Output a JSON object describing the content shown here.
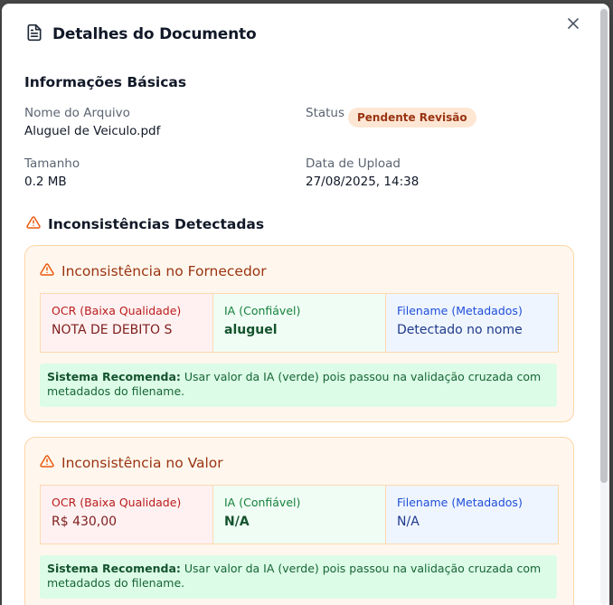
{
  "header": {
    "title": "Detalhes do Documento"
  },
  "basic_info": {
    "section_title": "Informações Básicas",
    "filename_label": "Nome do Arquivo",
    "filename_value": "Aluguel de Veiculo.pdf",
    "status_label": "Status",
    "status_value": "Pendente Revisão",
    "size_label": "Tamanho",
    "size_value": "0.2 MB",
    "upload_label": "Data de Upload",
    "upload_value": "27/08/2025, 14:38"
  },
  "inconsistencies": {
    "section_title": "Inconsistências Detectadas",
    "items": [
      {
        "title": "Inconsistência no Fornecedor",
        "ocr_label": "OCR (Baixa Qualidade)",
        "ocr_value": "NOTA DE DEBITO S",
        "ia_label": "IA (Confiável)",
        "ia_value": "aluguel",
        "filename_label": "Filename (Metadados)",
        "filename_value": "Detectado no nome",
        "reco_label": "Sistema Recomenda:",
        "reco_text": "Usar valor da IA (verde) pois passou na validação cruzada com metadados do filename."
      },
      {
        "title": "Inconsistência no Valor",
        "ocr_label": "OCR (Baixa Qualidade)",
        "ocr_value": "R$ 430,00",
        "ia_label": "IA (Confiável)",
        "ia_value": "N/A",
        "filename_label": "Filename (Metadados)",
        "filename_value": "N/A",
        "reco_label": "Sistema Recomenda:",
        "reco_text": "Usar valor da IA (verde) pois passou na validação cruzada com metadados do filename."
      }
    ]
  },
  "icons": {
    "document": "file-text-icon",
    "close": "close-icon",
    "warning": "warning-triangle-icon"
  },
  "colors": {
    "warning": "#ea580c",
    "status_badge_bg": "#fde7d4",
    "status_badge_text": "#9a3412",
    "ocr_text": "#b91c1c",
    "ia_text": "#15803d",
    "filename_text": "#1d4ed8"
  }
}
